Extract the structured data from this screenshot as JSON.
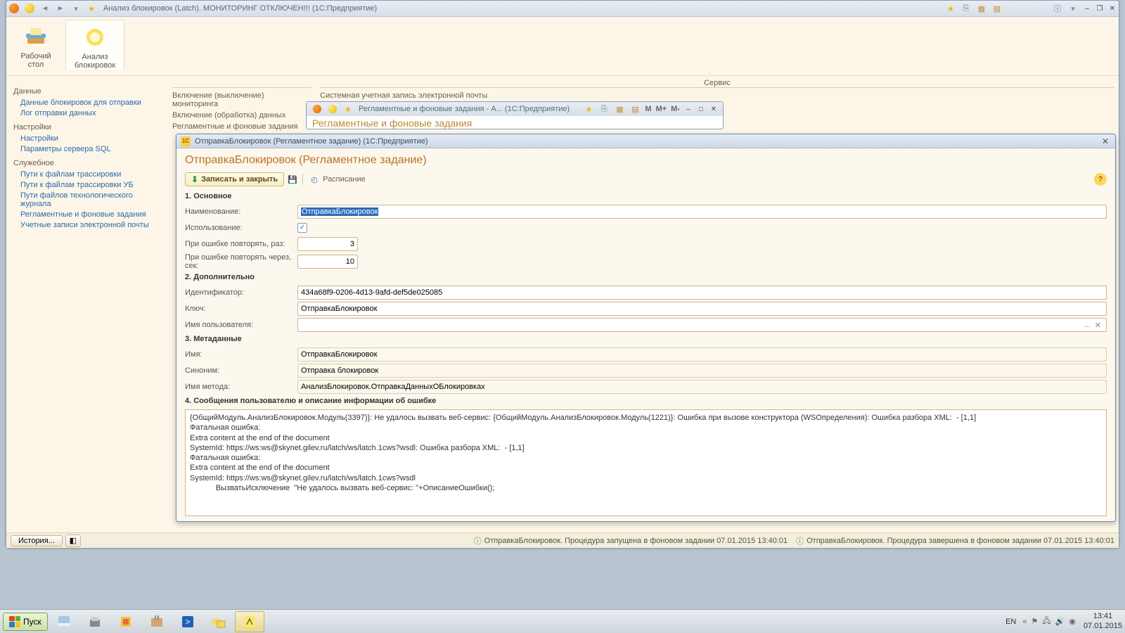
{
  "main_title": "Анализ блокировок (Latch).  МОНИТОРИНГ ОТКЛЮЧЕН!!!  (1С:Предприятие)",
  "sections": {
    "desktop": "Рабочий\nстол",
    "analysis": "Анализ\nблокировок"
  },
  "nav": {
    "g1": "Данные",
    "g1i": [
      "Данные блокировок для отправки",
      "Лог отправки данных"
    ],
    "g2": "Настройки",
    "g2i": [
      "Настройки",
      "Параметры сервера SQL"
    ],
    "g3": "Служебное",
    "g3i": [
      "Пути к файлам трассировки",
      "Пути к файлам трассировки УБ",
      "Пути файлов технологического журнала",
      "Регламентные и фоновые задания",
      "Учетные записи электронной почты"
    ]
  },
  "center": {
    "grp_service": "Сервис",
    "cmds_left": [
      "Включение (выключение) мониторинга",
      "Включение (обработка) данных",
      "Регламентные и фоновые задания"
    ],
    "cmds_right": [
      "Системная учетная запись электронной почты"
    ]
  },
  "win2": {
    "title": "Регламентные и фоновые задания - А...   (1С:Предприятие)",
    "header": "Регламентные и фоновые задания",
    "mem": [
      "M",
      "M+",
      "M-"
    ]
  },
  "dlg": {
    "title": "ОтправкаБлокировок (Регламентное задание)  (1С:Предприятие)",
    "header": "ОтправкаБлокировок (Регламентное задание)",
    "btn_save": "Записать и закрыть",
    "btn_sched": "Расписание",
    "sec1": "1. Основное",
    "l_name": "Наименование:",
    "v_name": "ОтправкаБлокировок",
    "l_use": "Использование:",
    "l_retry": "При ошибке повторять, раз:",
    "v_retry": "3",
    "l_retrysec": "При ошибке повторять через, сек:",
    "v_retrysec": "10",
    "sec2": "2. Дополнительно",
    "l_id": "Идентификатор:",
    "v_id": "434a68f9-0206-4d13-9afd-def5de025085",
    "l_key": "Ключ:",
    "v_key": "ОтправкаБлокировок",
    "l_user": "Имя пользователя:",
    "v_user": "",
    "sec3": "3. Метаданные",
    "l_mname": "Имя:",
    "v_mname": "ОтправкаБлокировок",
    "l_syn": "Синоним:",
    "v_syn": "Отправка блокировок",
    "l_meth": "Имя метода:",
    "v_meth": "АнализБлокировок.ОтправкаДанныхОБлокировках",
    "sec4": "4. Сообщения пользователю и описание информации об ошибке",
    "err": "{ОбщийМодуль.АнализБлокировок.Модуль(3397)}: Не удалось вызвать веб-сервис: {ОбщийМодуль.АнализБлокировок.Модуль(1221)}: Ошибка при вызове конструктора (WSОпределения): Ошибка разбора XML:  - [1,1]\nФатальная ошибка:\nExtra content at the end of the document\nSystemId: https://ws:ws@skynet.gilev.ru/latch/ws/latch.1cws?wsdl: Ошибка разбора XML:  - [1,1]\nФатальная ошибка:\nExtra content at the end of the document\nSystemId: https://ws:ws@skynet.gilev.ru/latch/ws/latch.1cws?wsdl\n            ВызватьИсключение  \"Не удалось вызвать веб-сервис: \"+ОписаниеОшибки();"
  },
  "status": {
    "history": "История...",
    "m1": "ОтправкаБлокировок. Процедура запущена в фоновом задании 07.01.2015 13:40:01",
    "m2": "ОтправкаБлокировок. Процедура завершена в фоновом задании 07.01.2015 13:40:01"
  },
  "taskbar": {
    "start": "Пуск",
    "lang": "EN",
    "time": "13:41",
    "date": "07.01.2015"
  }
}
